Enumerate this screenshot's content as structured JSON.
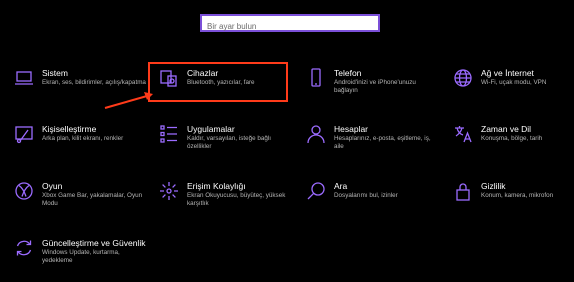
{
  "search": {
    "placeholder": "Bir ayar bulun"
  },
  "colors": {
    "accent": "#9b6bff",
    "highlight": "#ff3b1a"
  },
  "tiles": [
    {
      "title": "Sistem",
      "desc": "Ekran, ses, bildirimler, açılış/kapatma",
      "icon": "laptop-icon"
    },
    {
      "title": "Cihazlar",
      "desc": "Bluetooth, yazıcılar, fare",
      "icon": "devices-icon"
    },
    {
      "title": "Telefon",
      "desc": "Android'inizi ve iPhone'unuzu bağlayın",
      "icon": "phone-icon"
    },
    {
      "title": "Ağ ve İnternet",
      "desc": "Wi-Fi, uçak modu, VPN",
      "icon": "globe-icon"
    },
    {
      "title": "Kişiselleştirme",
      "desc": "Arka plan, kilit ekranı, renkler",
      "icon": "paintbrush-icon"
    },
    {
      "title": "Uygulamalar",
      "desc": "Kaldır, varsayılan, isteğe bağlı özellikler",
      "icon": "apps-list-icon"
    },
    {
      "title": "Hesaplar",
      "desc": "Hesaplarınız, e-posta, eşitleme, iş, aile",
      "icon": "person-icon"
    },
    {
      "title": "Zaman ve Dil",
      "desc": "Konuşma, bölge, tarih",
      "icon": "language-icon"
    },
    {
      "title": "Oyun",
      "desc": "Xbox Game Bar, yakalamalar, Oyun Modu",
      "icon": "xbox-icon"
    },
    {
      "title": "Erişim Kolaylığı",
      "desc": "Ekran Okuyucusu, büyüteç, yüksek karşıtlık",
      "icon": "ease-of-access-icon"
    },
    {
      "title": "Ara",
      "desc": "Dosyalarımı bul, izinler",
      "icon": "search-icon"
    },
    {
      "title": "Gizlilik",
      "desc": "Konum, kamera, mikrofon",
      "icon": "lock-icon"
    },
    {
      "title": "Güncelleştirme ve Güvenlik",
      "desc": "Windows Update, kurtarma, yedekleme",
      "icon": "update-icon"
    }
  ]
}
